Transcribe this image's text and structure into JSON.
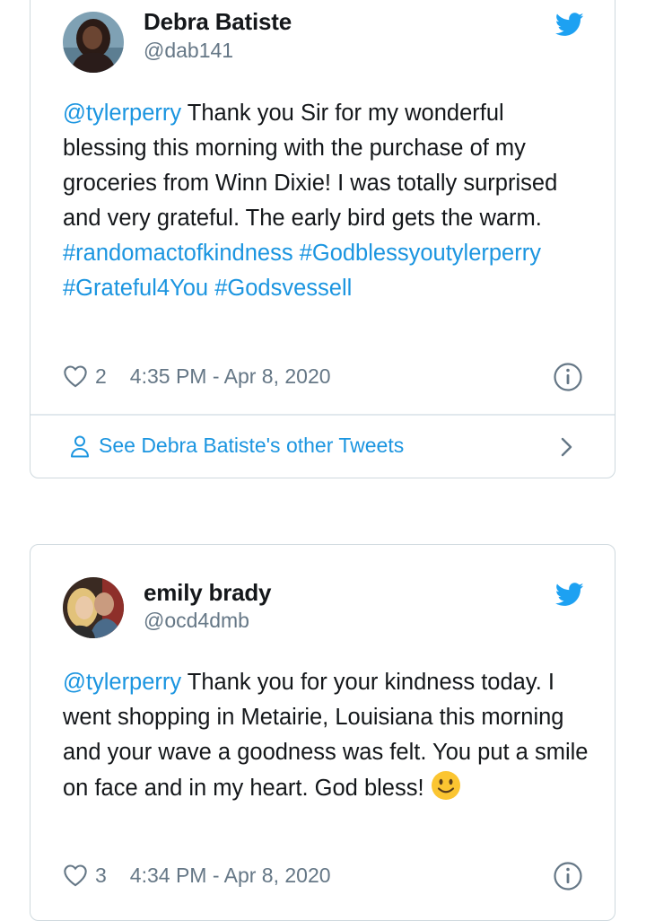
{
  "tweets": [
    {
      "name": "Debra Batiste",
      "handle": "@dab141",
      "text_parts": {
        "mention": "@tylerperry",
        "body": " Thank you Sir for my wonderful blessing this morning with the purchase of my groceries from Winn Dixie! I was totally surprised and very grateful. The early bird gets the warm. ",
        "hashtag1": "#randomactofkindness",
        "hashtag2": "#Godblessyoutylerperry",
        "hashtag3": "#Grateful4You",
        "hashtag4": "#Godsvessell"
      },
      "likes": "2",
      "timestamp": "4:35 PM - Apr 8, 2020",
      "other_tweets_label": "See Debra Batiste's other Tweets"
    },
    {
      "name": "emily brady",
      "handle": "@ocd4dmb",
      "text_parts": {
        "mention": "@tylerperry",
        "body": " Thank you for your kindness today. I went shopping in Metairie, Louisiana this morning and your wave a goodness was felt. You put a smile on face and in my heart. God bless! "
      },
      "likes": "3",
      "timestamp": "4:34 PM - Apr 8, 2020"
    }
  ],
  "colors": {
    "link": "#1b95e0",
    "muted": "#657786",
    "border": "#cfd9de"
  },
  "icons": [
    "twitter-bird-icon",
    "heart-icon",
    "info-icon",
    "person-icon",
    "chevron-right-icon",
    "smiley-emoji-icon"
  ]
}
